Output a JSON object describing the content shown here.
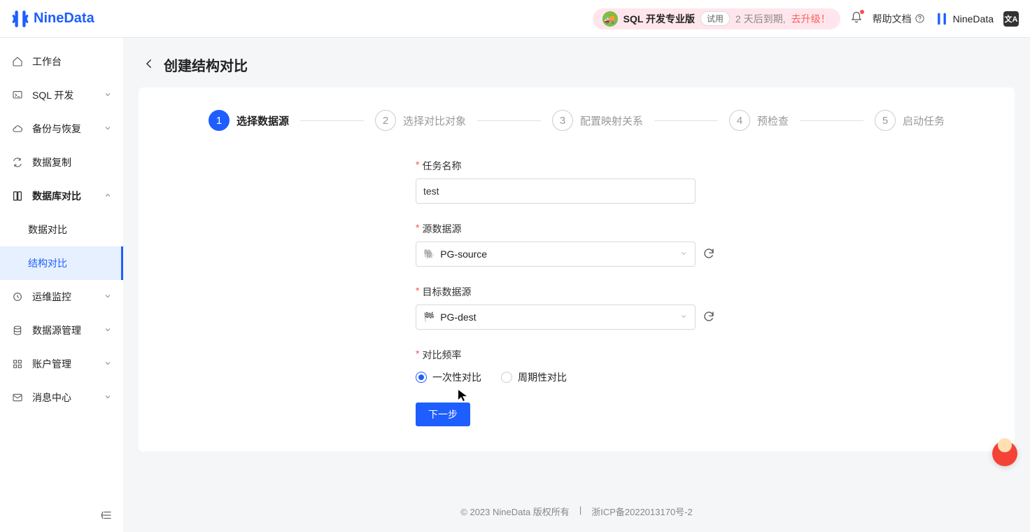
{
  "brand": "NineData",
  "header": {
    "promo_product": "SQL 开发专业版",
    "badge_try": "试用",
    "promo_expiry": "2 天后到期,",
    "promo_upgrade": "去升级！",
    "help_text": "帮助文档",
    "user_name": "NineData"
  },
  "sidebar": {
    "workspace": "工作台",
    "sql_dev": "SQL 开发",
    "backup": "备份与恢复",
    "replication": "数据复制",
    "db_compare": "数据库对比",
    "data_compare": "数据对比",
    "struct_compare": "结构对比",
    "ops_monitor": "运维监控",
    "ds_manage": "数据源管理",
    "account_manage": "账户管理",
    "message_center": "消息中心"
  },
  "page": {
    "title": "创建结构对比"
  },
  "steps": {
    "s1": {
      "n": "1",
      "label": "选择数据源"
    },
    "s2": {
      "n": "2",
      "label": "选择对比对象"
    },
    "s3": {
      "n": "3",
      "label": "配置映射关系"
    },
    "s4": {
      "n": "4",
      "label": "预检查"
    },
    "s5": {
      "n": "5",
      "label": "启动任务"
    }
  },
  "form": {
    "task_name_label": "任务名称",
    "task_name_value": "test",
    "source_ds_label": "源数据源",
    "source_ds_value": "PG-source",
    "target_ds_label": "目标数据源",
    "target_ds_value": "PG-dest",
    "freq_label": "对比频率",
    "freq_once": "一次性对比",
    "freq_periodic": "周期性对比",
    "next_btn": "下一步"
  },
  "footer": {
    "copyright": "2023 NineData 版权所有",
    "icp": "浙ICP备2022013170号-2"
  }
}
